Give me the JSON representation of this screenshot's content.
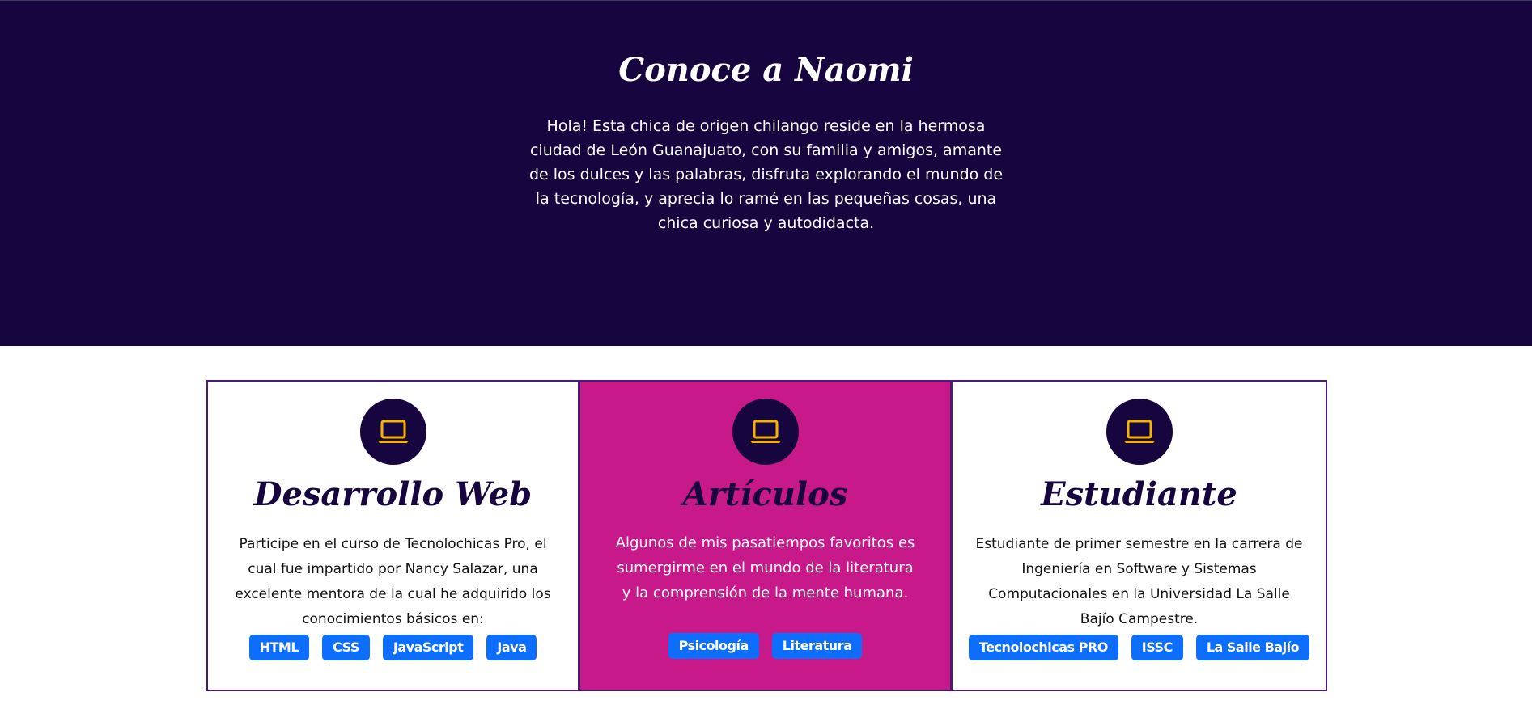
{
  "hero": {
    "title": "Conoce a Naomi",
    "text": "Hola! Esta chica de origen chilango reside en la hermosa ciudad de León Guanajuato, con su familia y amigos, amante de los dulces y las palabras, disfruta explorando el mundo de la tecnología, y aprecia lo ramé en las pequeñas cosas, una chica curiosa y autodidacta."
  },
  "colors": {
    "hero_bg": "#170540",
    "accent_pink": "#c8198a",
    "tag_blue": "#0d6efd",
    "icon_yellow": "#f5b400"
  },
  "cards": [
    {
      "icon": "laptop-icon",
      "title": "Desarrollo Web",
      "text": "Participe en el curso de Tecnolochicas Pro, el cual fue impartido por Nancy Salazar, una excelente mentora de la cual he adquirido los conocimientos básicos en:",
      "tags": [
        "HTML",
        "CSS",
        "JavaScript",
        "Java"
      ]
    },
    {
      "icon": "laptop-icon",
      "title": "Artículos",
      "text": "Algunos de mis pasatiempos favoritos es sumergirme en el mundo de la literatura y la comprensión de la mente humana.",
      "tags": [
        "Psicología",
        "Literatura"
      ]
    },
    {
      "icon": "laptop-icon",
      "title": "Estudiante",
      "text": "Estudiante de primer semestre en la carrera de Ingeniería en Software y Sistemas Computacionales en la Universidad La Salle Bajío Campestre.",
      "tags": [
        "Tecnolochicas PRO",
        "ISSC",
        "La Salle Bajío"
      ]
    }
  ]
}
